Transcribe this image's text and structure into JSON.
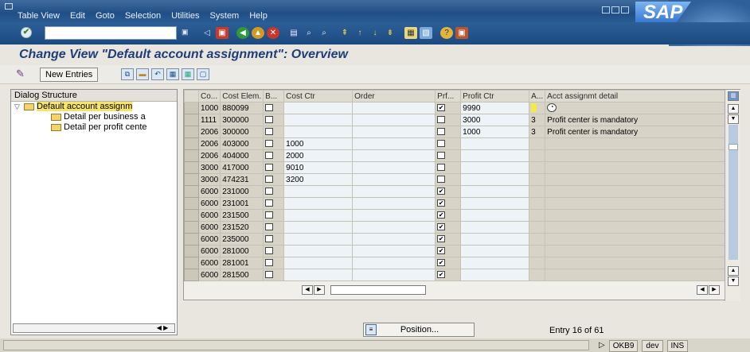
{
  "menu": {
    "items": [
      "Table View",
      "Edit",
      "Goto",
      "Selection",
      "Utilities",
      "System",
      "Help"
    ],
    "logo": "SAP"
  },
  "page_title": "Change View \"Default account assignment\": Overview",
  "app_toolbar": {
    "new_entries": "New Entries"
  },
  "dialog_structure": {
    "header": "Dialog Structure",
    "items": [
      {
        "label": "Default account assignm",
        "level": 0,
        "selected": true
      },
      {
        "label": "Detail per business a",
        "level": 1
      },
      {
        "label": "Detail per profit cente",
        "level": 1
      }
    ]
  },
  "table": {
    "columns": [
      "Co...",
      "Cost Elem.",
      "B...",
      "Cost Ctr",
      "Order",
      "Prf...",
      "Profit Ctr",
      "A...",
      "Acct assignmt detail"
    ],
    "rows": [
      {
        "co": "1000",
        "cost_elem": "880099",
        "cost_ctr": "",
        "order": "",
        "prf": true,
        "profit_ctr": "9990",
        "a": "",
        "detail": "",
        "has_f4": true
      },
      {
        "co": "1111",
        "cost_elem": "300000",
        "cost_ctr": "",
        "order": "",
        "prf": false,
        "profit_ctr": "3000",
        "a": "3",
        "detail": "Profit center is mandatory"
      },
      {
        "co": "2006",
        "cost_elem": "300000",
        "cost_ctr": "",
        "order": "",
        "prf": false,
        "profit_ctr": "1000",
        "a": "3",
        "detail": "Profit center is mandatory"
      },
      {
        "co": "2006",
        "cost_elem": "403000",
        "cost_ctr": "1000",
        "order": "",
        "prf": false,
        "profit_ctr": "",
        "a": "",
        "detail": ""
      },
      {
        "co": "2006",
        "cost_elem": "404000",
        "cost_ctr": "2000",
        "order": "",
        "prf": false,
        "profit_ctr": "",
        "a": "",
        "detail": ""
      },
      {
        "co": "3000",
        "cost_elem": "417000",
        "cost_ctr": "9010",
        "order": "",
        "prf": false,
        "profit_ctr": "",
        "a": "",
        "detail": ""
      },
      {
        "co": "3000",
        "cost_elem": "474231",
        "cost_ctr": "3200",
        "order": "",
        "prf": false,
        "profit_ctr": "",
        "a": "",
        "detail": ""
      },
      {
        "co": "6000",
        "cost_elem": "231000",
        "cost_ctr": "",
        "order": "",
        "prf": true,
        "profit_ctr": "",
        "a": "",
        "detail": ""
      },
      {
        "co": "6000",
        "cost_elem": "231001",
        "cost_ctr": "",
        "order": "",
        "prf": true,
        "profit_ctr": "",
        "a": "",
        "detail": ""
      },
      {
        "co": "6000",
        "cost_elem": "231500",
        "cost_ctr": "",
        "order": "",
        "prf": true,
        "profit_ctr": "",
        "a": "",
        "detail": ""
      },
      {
        "co": "6000",
        "cost_elem": "231520",
        "cost_ctr": "",
        "order": "",
        "prf": true,
        "profit_ctr": "",
        "a": "",
        "detail": ""
      },
      {
        "co": "6000",
        "cost_elem": "235000",
        "cost_ctr": "",
        "order": "",
        "prf": true,
        "profit_ctr": "",
        "a": "",
        "detail": ""
      },
      {
        "co": "6000",
        "cost_elem": "281000",
        "cost_ctr": "",
        "order": "",
        "prf": true,
        "profit_ctr": "",
        "a": "",
        "detail": ""
      },
      {
        "co": "6000",
        "cost_elem": "281001",
        "cost_ctr": "",
        "order": "",
        "prf": true,
        "profit_ctr": "",
        "a": "",
        "detail": ""
      },
      {
        "co": "6000",
        "cost_elem": "281500",
        "cost_ctr": "",
        "order": "",
        "prf": true,
        "profit_ctr": "",
        "a": "",
        "detail": ""
      }
    ]
  },
  "bottom": {
    "position_button": "Position...",
    "entry_info": "Entry 16 of 61"
  },
  "status": {
    "transaction": "OKB9",
    "system": "dev",
    "mode": "INS"
  },
  "colors": {
    "title": "#1f3d7a",
    "header_bar": "#1f4f86",
    "selection": "#f5e36b"
  }
}
